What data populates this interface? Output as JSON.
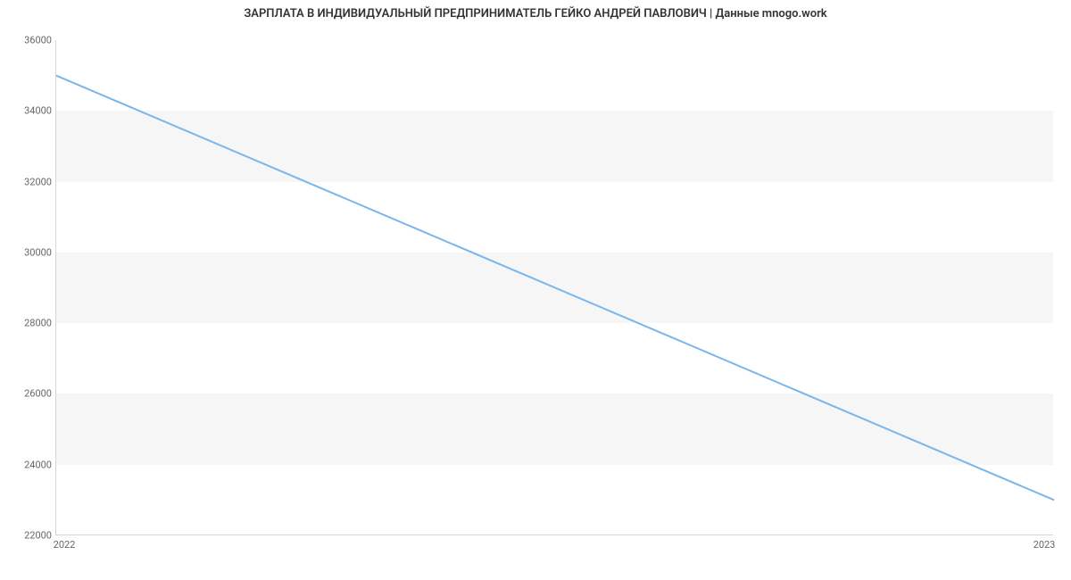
{
  "chart_data": {
    "type": "line",
    "title": "ЗАРПЛАТА В ИНДИВИДУАЛЬНЫЙ ПРЕДПРИНИМАТЕЛЬ ГЕЙКО АНДРЕЙ ПАВЛОВИЧ | Данные mnogo.work",
    "xlabel": "",
    "ylabel": "",
    "x": [
      2022,
      2023
    ],
    "values": [
      35000,
      23000
    ],
    "x_ticks": [
      "2022",
      "2023"
    ],
    "y_ticks": [
      22000,
      24000,
      26000,
      28000,
      30000,
      32000,
      34000,
      36000
    ],
    "ylim": [
      22000,
      36000
    ],
    "line_color": "#7cb5ec",
    "band_color": "#f6f6f6"
  }
}
